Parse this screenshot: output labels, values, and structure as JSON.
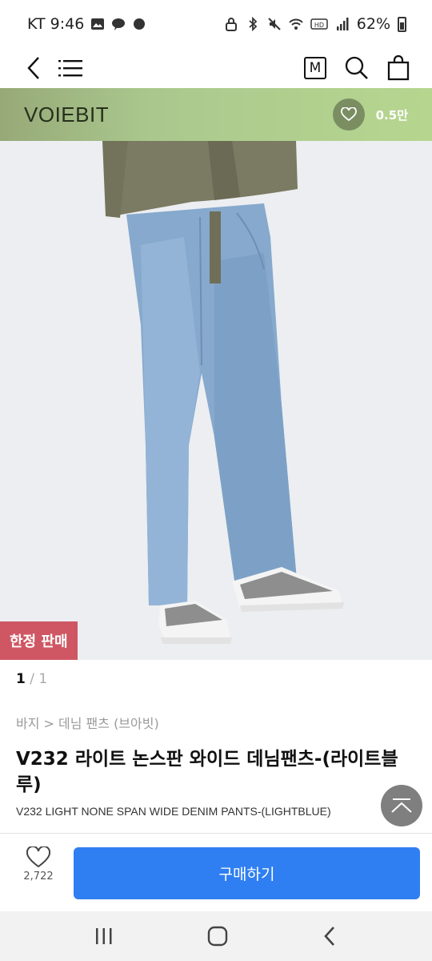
{
  "status": {
    "carrier_time": "KT 9:46",
    "battery": "62%"
  },
  "nav": {
    "m_label": "M"
  },
  "brand": {
    "name": "VOIEBIT",
    "likes": "0.5만"
  },
  "product": {
    "badge": "한정 판매",
    "image_index": "1",
    "image_sep": "/",
    "image_total": "1",
    "breadcrumb": "바지 > 데님 팬츠 (브아빗)",
    "title": "V232 라이트 논스판 와이드 데님팬츠-(라이트블루)",
    "subtitle": "V232 LIGHT NONE SPAN WIDE DENIM PANTS-(LIGHTBLUE)"
  },
  "bottom": {
    "wish_count": "2,722",
    "buy_label": "구매하기"
  },
  "colors": {
    "brand_bar": "#aac88e",
    "badge": "#cf5763",
    "buy_button": "#2f7ff2"
  }
}
